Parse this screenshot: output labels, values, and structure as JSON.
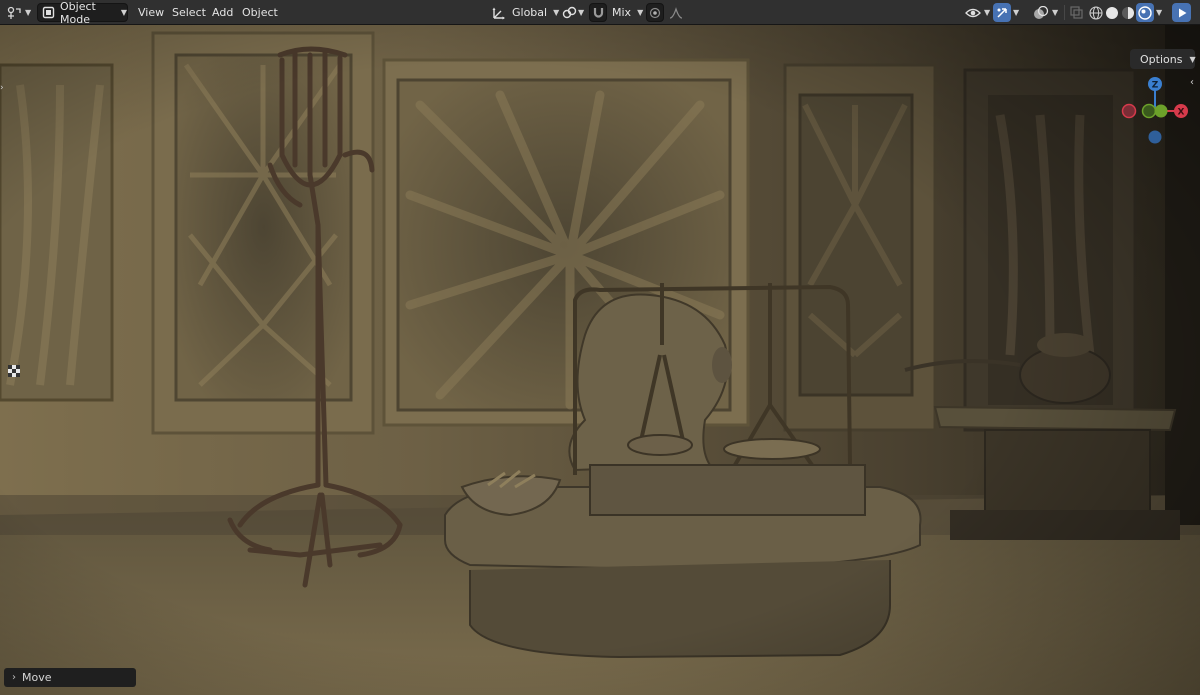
{
  "header": {
    "mode_label": "Object Mode",
    "menus": [
      "View",
      "Select",
      "Add",
      "Object"
    ],
    "transform_orientation": "Global",
    "proportional_falloff": "Mix"
  },
  "viewport": {
    "options_label": "Options",
    "gizmo_axes": {
      "z": "Z",
      "x": "X"
    }
  },
  "operator_panel": {
    "label": "Move"
  },
  "colors": {
    "header_bg": "#303030",
    "active_blue": "#4772b3",
    "axis_x": "#d63a4b",
    "axis_y": "#6ca12a",
    "axis_z": "#3a7fd0"
  },
  "icons": {
    "editor_type": "scene-editor-icon",
    "mode": "object-mode-icon",
    "orientation": "transform-orientation-icon",
    "pivot": "pivot-point-icon",
    "snap": "snap-magnet-icon",
    "proportional": "proportional-editing-icon",
    "visibility": "visibility-eye-icon",
    "gizmo": "gizmo-arrows-icon",
    "overlay": "overlay-icon",
    "xray": "xray-icon",
    "shading": [
      "wireframe-shading-icon",
      "solid-shading-icon",
      "material-shading-icon",
      "rendered-shading-icon"
    ],
    "render": "render-play-icon"
  }
}
